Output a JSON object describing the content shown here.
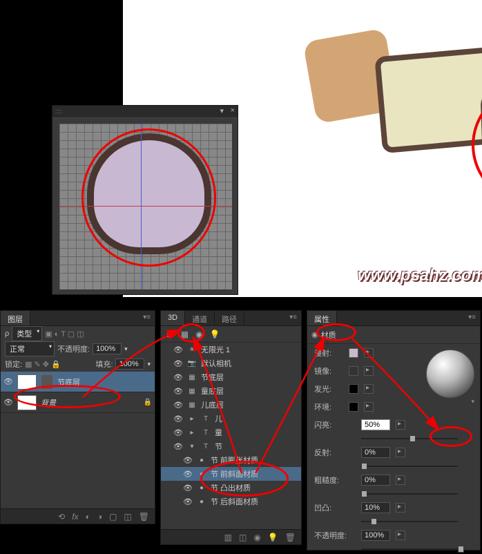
{
  "watermark": "www.psahz.com",
  "layers_panel": {
    "tab": "图层",
    "filter_label": "类型",
    "blend": "正常",
    "opacity_label": "不透明度:",
    "opacity": "100%",
    "lock_label": "锁定:",
    "fill_label": "填充:",
    "fill": "100%",
    "items": [
      {
        "name": "节底层",
        "selected": true
      },
      {
        "name": "背景",
        "selected": false
      }
    ]
  },
  "d3_panel": {
    "tabs": [
      "3D",
      "通道",
      "路径"
    ],
    "items": [
      {
        "name": "无限光 1",
        "ic": "☀",
        "i": 1
      },
      {
        "name": "默认相机",
        "ic": "📷",
        "i": 1
      },
      {
        "name": "节底层",
        "ic": "▦",
        "i": 1
      },
      {
        "name": "童底层",
        "ic": "▦",
        "i": 1
      },
      {
        "name": "儿底层",
        "ic": "▦",
        "i": 1
      },
      {
        "name": "儿",
        "ic": "T",
        "i": 1,
        "exp": "▸"
      },
      {
        "name": "童",
        "ic": "T",
        "i": 1,
        "exp": "▸"
      },
      {
        "name": "节",
        "ic": "T",
        "i": 1,
        "exp": "▾"
      },
      {
        "name": "节 前膨胀材质",
        "ic": "●",
        "i": 2
      },
      {
        "name": "节 前斜面材质",
        "ic": "●",
        "i": 2,
        "sel": true
      },
      {
        "name": "节 凸出材质",
        "ic": "●",
        "i": 2
      },
      {
        "name": "节 后斜面材质",
        "ic": "●",
        "i": 2
      }
    ]
  },
  "props_panel": {
    "tab": "属性",
    "header": "材质",
    "rows": {
      "diffuse": "漫射:",
      "specular": "镜像:",
      "glow": "发光:",
      "ambient": "环境:"
    },
    "sliders": [
      {
        "name": "闪亮:",
        "val": "50%",
        "knob": 50,
        "hl": true
      },
      {
        "name": "反射:",
        "val": "0%",
        "knob": 0
      },
      {
        "name": "粗糙度:",
        "val": "0%",
        "knob": 0
      },
      {
        "name": "凹凸:",
        "val": "10%",
        "knob": 10
      },
      {
        "name": "不透明度:",
        "val": "100%",
        "knob": 100
      }
    ]
  }
}
